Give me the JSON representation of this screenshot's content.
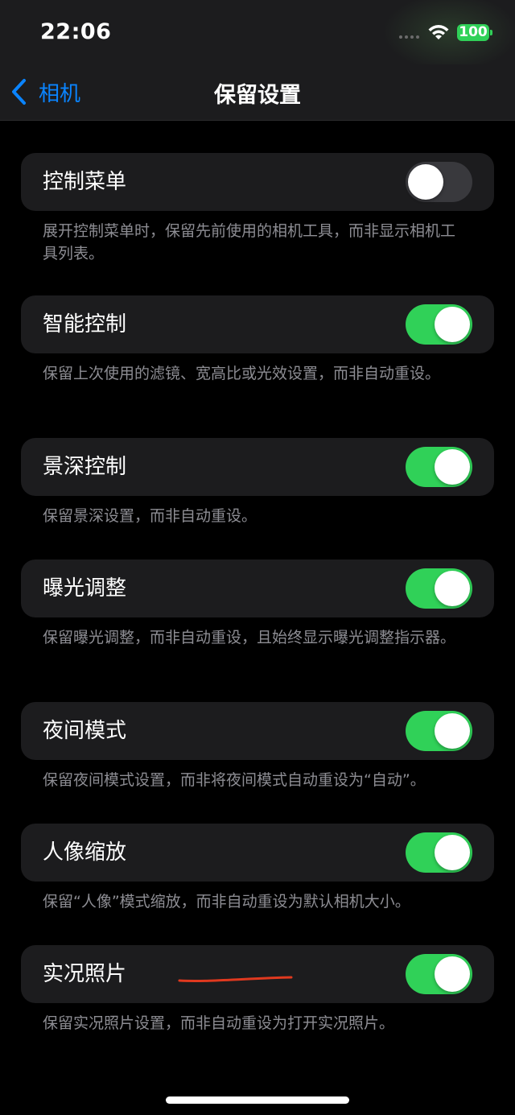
{
  "status": {
    "time": "22:06",
    "battery": "100"
  },
  "nav": {
    "back_label": "相机",
    "title": "保留设置"
  },
  "colors": {
    "accent": "#0a84ff",
    "toggle_on": "#30d158",
    "toggle_off": "#39393d",
    "annotation": "#e0391f"
  },
  "settings": [
    {
      "label": "控制菜单",
      "on": false,
      "footer": "展开控制菜单时，保留先前使用的相机工具，而非显示相机工具列表。"
    },
    {
      "label": "智能控制",
      "on": true,
      "footer": "保留上次使用的滤镜、宽高比或光效设置，而非自动重设。"
    },
    {
      "label": "景深控制",
      "on": true,
      "footer": "保留景深设置，而非自动重设。"
    },
    {
      "label": "曝光调整",
      "on": true,
      "footer": "保留曝光调整，而非自动重设，且始终显示曝光调整指示器。"
    },
    {
      "label": "夜间模式",
      "on": true,
      "footer": "保留夜间模式设置，而非将夜间模式自动重设为“自动”。"
    },
    {
      "label": "人像缩放",
      "on": true,
      "footer": "保留“人像”模式缩放，而非自动重设为默认相机大小。"
    },
    {
      "label": "实况照片",
      "on": true,
      "footer": "保留实况照片设置，而非自动重设为打开实况照片。"
    }
  ]
}
